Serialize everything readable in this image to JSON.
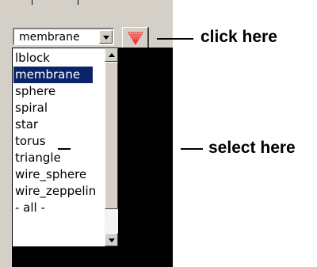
{
  "combo": {
    "selected": "membrane"
  },
  "list": {
    "items": [
      {
        "label": "lblock",
        "selected": false
      },
      {
        "label": "membrane",
        "selected": true
      },
      {
        "label": "sphere",
        "selected": false
      },
      {
        "label": "spiral",
        "selected": false
      },
      {
        "label": "star",
        "selected": false
      },
      {
        "label": "torus",
        "selected": false
      },
      {
        "label": "triangle",
        "selected": false
      },
      {
        "label": "wire_sphere",
        "selected": false
      },
      {
        "label": "wire_zeppelin",
        "selected": false
      },
      {
        "label": "- all -",
        "selected": false
      }
    ]
  },
  "annotations": {
    "click": "click here",
    "select": "select here"
  },
  "colors": {
    "selection": "#0a246a",
    "panel": "#d4d0c8",
    "icon": "#ff3333"
  },
  "icons": {
    "tool_button": "red-mesh-icon"
  }
}
